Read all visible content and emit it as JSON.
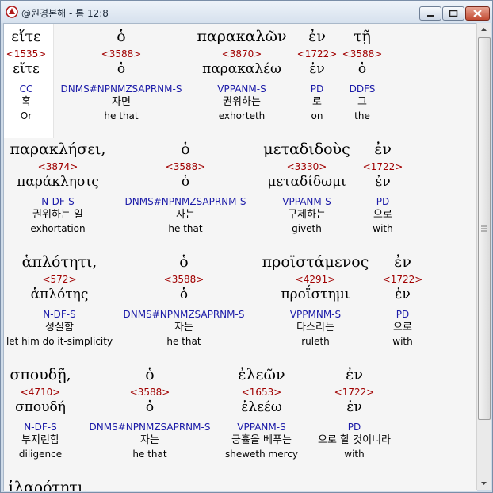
{
  "window": {
    "title": "@원경본해 - 롬 12:8"
  },
  "verses": [
    {
      "words": [
        {
          "greek": "εἴτε",
          "strong": "<1535>",
          "lemma": "εἴτε",
          "parse": "CC",
          "korean": "혹",
          "english": "Or"
        },
        {
          "greek": "ὁ",
          "strong": "<3588>",
          "lemma": "ὁ",
          "parse": "DNMS#NPNMZSAPRNM-S",
          "korean": "자면",
          "english": "he that"
        },
        {
          "greek": "παρακαλῶν",
          "strong": "<3870>",
          "lemma": "παρακαλέω",
          "parse": "VPPANM-S",
          "korean": "권위하는",
          "english": "exhorteth"
        },
        {
          "greek": "ἐν",
          "strong": "<1722>",
          "lemma": "ἐν",
          "parse": "PD",
          "korean": "로",
          "english": "on"
        },
        {
          "greek": "τῇ",
          "strong": "<3588>",
          "lemma": "ὁ",
          "parse": "DDFS",
          "korean": "그",
          "english": "the"
        }
      ]
    },
    {
      "words": [
        {
          "greek": "παρακλήσει,",
          "strong": "<3874>",
          "lemma": "παράκλησις",
          "parse": "N-DF-S",
          "korean": "권위하는 일",
          "english": "exhortation"
        },
        {
          "greek": "ὁ",
          "strong": "<3588>",
          "lemma": "ὁ",
          "parse": "DNMS#NPNMZSAPRNM-S",
          "korean": "자는",
          "english": "he that"
        },
        {
          "greek": "μεταδιδοὺς",
          "strong": "<3330>",
          "lemma": "μεταδίδωμι",
          "parse": "VPPANM-S",
          "korean": "구제하는",
          "english": "giveth"
        },
        {
          "greek": "ἐν",
          "strong": "<1722>",
          "lemma": "ἐν",
          "parse": "PD",
          "korean": "으로",
          "english": "with"
        }
      ]
    },
    {
      "words": [
        {
          "greek": "ἁπλότητι,",
          "strong": "<572>",
          "lemma": "ἁπλότης",
          "parse": "N-DF-S",
          "korean": "성실함",
          "english": "let him do it-simplicity"
        },
        {
          "greek": "ὁ",
          "strong": "<3588>",
          "lemma": "ὁ",
          "parse": "DNMS#NPNMZSAPRNM-S",
          "korean": "자는",
          "english": "he that"
        },
        {
          "greek": "προϊστάμενος",
          "strong": "<4291>",
          "lemma": "προΐστημι",
          "parse": "VPPMNM-S",
          "korean": "다스리는",
          "english": "ruleth"
        },
        {
          "greek": "ἐν",
          "strong": "<1722>",
          "lemma": "ἐν",
          "parse": "PD",
          "korean": "으로",
          "english": "with"
        }
      ]
    },
    {
      "words": [
        {
          "greek": "σπουδῇ,",
          "strong": "<4710>",
          "lemma": "σπουδή",
          "parse": "N-DF-S",
          "korean": "부지런함",
          "english": "diligence"
        },
        {
          "greek": "ὁ",
          "strong": "<3588>",
          "lemma": "ὁ",
          "parse": "DNMS#NPNMZSAPRNM-S",
          "korean": "자는",
          "english": "he that"
        },
        {
          "greek": "ἐλεῶν",
          "strong": "<1653>",
          "lemma": "ἐλεέω",
          "parse": "VPPANM-S",
          "korean": "긍휼을 베푸는",
          "english": "sheweth mercy"
        },
        {
          "greek": "ἐν",
          "strong": "<1722>",
          "lemma": "ἐν",
          "parse": "PD",
          "korean": "으로 할 것이니라",
          "english": "with"
        }
      ]
    },
    {
      "words": [
        {
          "greek": "ἱλαρότητι.",
          "strong": "",
          "lemma": "",
          "parse": "",
          "korean": "",
          "english": ""
        }
      ]
    }
  ]
}
